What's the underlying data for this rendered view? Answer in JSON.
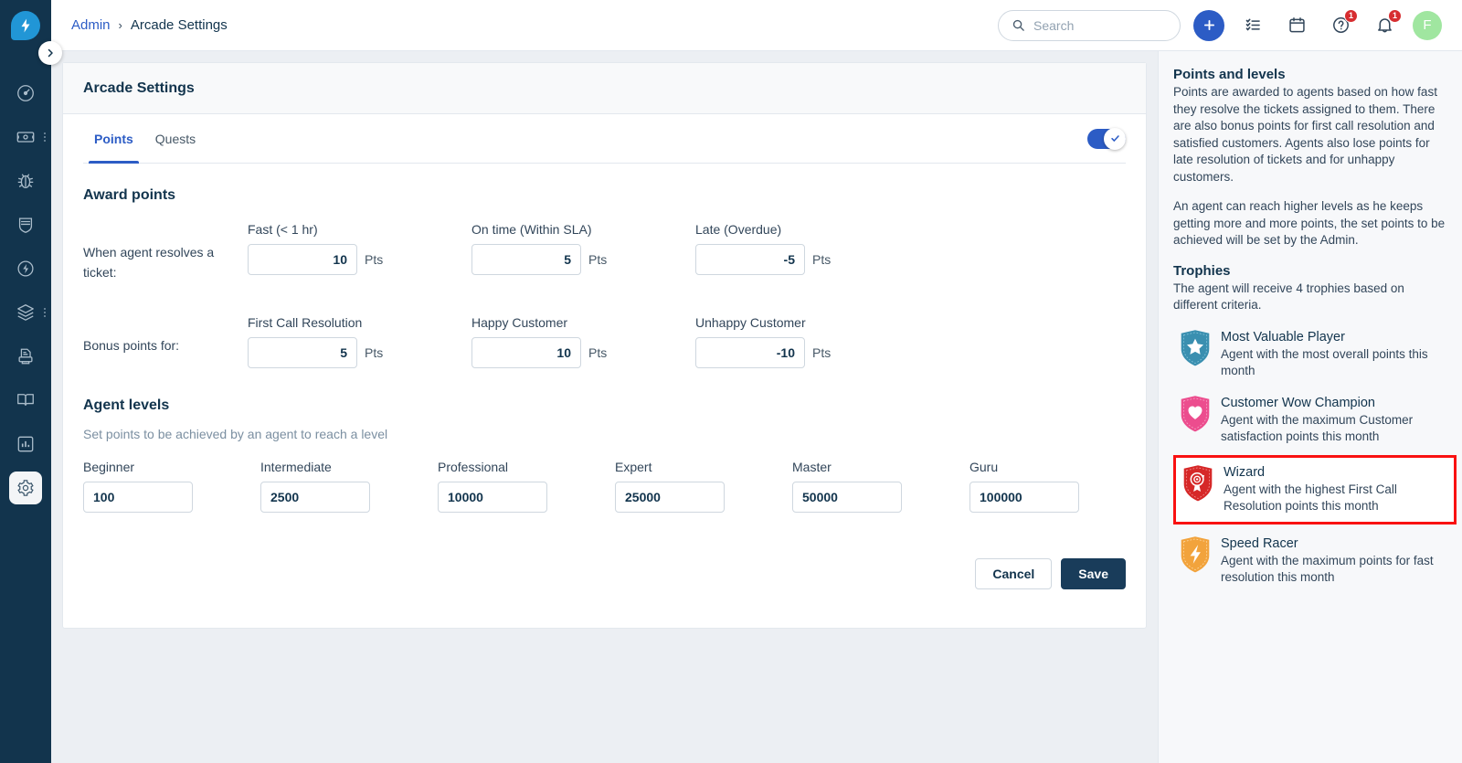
{
  "app": {
    "logo_icon": "freshworks-bolt-logo",
    "collapse_icon": "chevron-right-icon"
  },
  "sidebar": {
    "items": [
      {
        "name": "dashboard",
        "icon": "speedometer-icon",
        "active": false,
        "has_more": false
      },
      {
        "name": "tickets",
        "icon": "ticket-icon",
        "active": false,
        "has_more": true
      },
      {
        "name": "problems",
        "icon": "bug-icon",
        "active": false,
        "has_more": false
      },
      {
        "name": "changes",
        "icon": "shield-icon",
        "active": false,
        "has_more": false
      },
      {
        "name": "releases",
        "icon": "flash-circle-icon",
        "active": false,
        "has_more": false
      },
      {
        "name": "assets",
        "icon": "layers-icon",
        "active": false,
        "has_more": true
      },
      {
        "name": "purchase-orders",
        "icon": "document-printer-icon",
        "active": false,
        "has_more": false
      },
      {
        "name": "solutions",
        "icon": "book-icon",
        "active": false,
        "has_more": false
      },
      {
        "name": "analytics",
        "icon": "bar-chart-icon",
        "active": false,
        "has_more": false
      },
      {
        "name": "admin",
        "icon": "gear-icon",
        "active": true,
        "has_more": false
      }
    ]
  },
  "topbar": {
    "breadcrumb": {
      "parent": "Admin",
      "separator": "›",
      "current": "Arcade Settings"
    },
    "search": {
      "placeholder": "Search",
      "value": "",
      "icon": "search-icon"
    },
    "add_button_icon": "plus-icon",
    "todo_icon": "checklist-icon",
    "calendar_icon": "calendar-icon",
    "help": {
      "icon": "question-circle-icon",
      "badge": "1"
    },
    "notifications": {
      "icon": "bell-icon",
      "badge": "1"
    },
    "avatar": {
      "initial": "F",
      "color": "#a0e6a0"
    }
  },
  "page": {
    "title": "Arcade Settings",
    "tabs": [
      {
        "label": "Points",
        "active": true
      },
      {
        "label": "Quests",
        "active": false
      }
    ],
    "master_toggle": {
      "enabled": true,
      "icon": "check-icon"
    },
    "award_points": {
      "heading": "Award points",
      "resolve_label": "When agent resolves a ticket:",
      "resolve_fields": [
        {
          "label": "Fast (< 1 hr)",
          "value": "10",
          "unit": "Pts"
        },
        {
          "label": "On time (Within SLA)",
          "value": "5",
          "unit": "Pts"
        },
        {
          "label": "Late (Overdue)",
          "value": "-5",
          "unit": "Pts"
        }
      ],
      "bonus_label": "Bonus points for:",
      "bonus_fields": [
        {
          "label": "First Call Resolution",
          "value": "5",
          "unit": "Pts"
        },
        {
          "label": "Happy Customer",
          "value": "10",
          "unit": "Pts"
        },
        {
          "label": "Unhappy Customer",
          "value": "-10",
          "unit": "Pts"
        }
      ]
    },
    "agent_levels": {
      "heading": "Agent levels",
      "subtitle": "Set points to be achieved by an agent to reach a level",
      "levels": [
        {
          "label": "Beginner",
          "value": "100"
        },
        {
          "label": "Intermediate",
          "value": "2500"
        },
        {
          "label": "Professional",
          "value": "10000"
        },
        {
          "label": "Expert",
          "value": "25000"
        },
        {
          "label": "Master",
          "value": "50000"
        },
        {
          "label": "Guru",
          "value": "100000"
        }
      ]
    },
    "actions": {
      "cancel": "Cancel",
      "save": "Save"
    }
  },
  "info_panel": {
    "points_heading": "Points and levels",
    "points_para_1": "Points are awarded to agents based on how fast they resolve the tickets assigned to them. There are also bonus points for first call resolution and satisfied customers. Agents also lose points for late resolution of tickets and for unhappy customers.",
    "points_para_2": "An agent can reach higher levels as he keeps getting more and more points, the set points to be achieved will be set by the Admin.",
    "trophies_heading": "Trophies",
    "trophies_intro": "The agent will receive 4 trophies based on different criteria.",
    "trophies": [
      {
        "name": "Most Valuable Player",
        "description": "Agent with the most overall points this month",
        "icon": "shield-star-icon",
        "color": "#3a8fb0",
        "highlighted": false
      },
      {
        "name": "Customer Wow Champion",
        "description": "Agent with the maximum Customer satisfaction points this month",
        "icon": "shield-heart-icon",
        "color": "#ec4d8e",
        "highlighted": false
      },
      {
        "name": "Wizard",
        "description": "Agent with the highest First Call Resolution points this month",
        "icon": "shield-target-icon",
        "color": "#d62828",
        "highlighted": true
      },
      {
        "name": "Speed Racer",
        "description": "Agent with the maximum points for fast resolution this month",
        "icon": "shield-bolt-icon",
        "color": "#f2a33c",
        "highlighted": false
      }
    ]
  },
  "colors": {
    "sidebar_bg": "#12344d",
    "accent_blue": "#2c5cc5",
    "save_btn": "#193c5a",
    "highlight_border": "#f91111",
    "page_bg": "#eceff3"
  }
}
